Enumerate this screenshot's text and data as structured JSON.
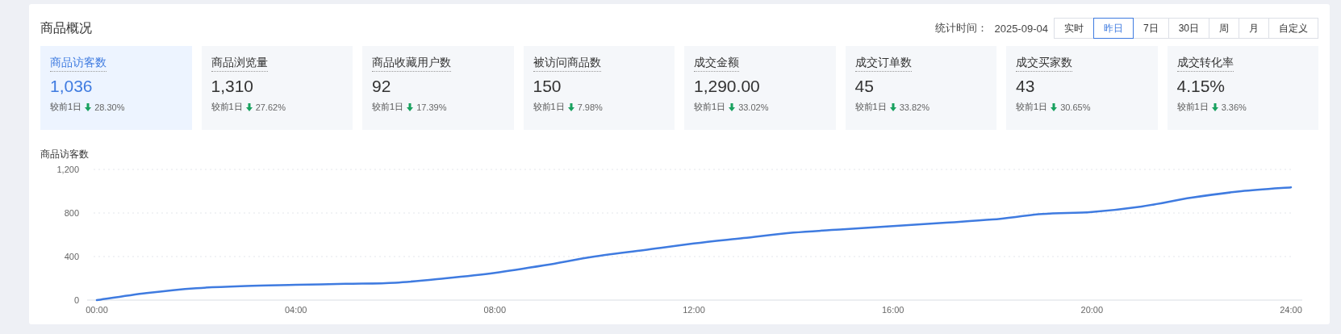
{
  "title": "商品概况",
  "stat_time": {
    "label": "统计时间：",
    "value": "2025-09-04"
  },
  "ranges": [
    {
      "label": "实时",
      "selected": false
    },
    {
      "label": "昨日",
      "selected": true
    },
    {
      "label": "7日",
      "selected": false
    },
    {
      "label": "30日",
      "selected": false
    },
    {
      "label": "周",
      "selected": false
    },
    {
      "label": "月",
      "selected": false
    },
    {
      "label": "自定义",
      "selected": false
    }
  ],
  "metrics": [
    {
      "name": "商品访客数",
      "value": "1,036",
      "compare": "较前1日",
      "kind": "decrease",
      "change": "28.30%",
      "selected": true
    },
    {
      "name": "商品浏览量",
      "value": "1,310",
      "compare": "较前1日",
      "kind": "decrease",
      "change": "27.62%",
      "selected": false
    },
    {
      "name": "商品收藏用户数",
      "value": "92",
      "compare": "较前1日",
      "kind": "decrease",
      "change": "17.39%",
      "selected": false
    },
    {
      "name": "被访问商品数",
      "value": "150",
      "compare": "较前1日",
      "kind": "decrease",
      "change": "7.98%",
      "selected": false
    },
    {
      "name": "成交金额",
      "value": "1,290.00",
      "compare": "较前1日",
      "kind": "decrease",
      "change": "33.02%",
      "selected": false
    },
    {
      "name": "成交订单数",
      "value": "45",
      "compare": "较前1日",
      "kind": "decrease",
      "change": "33.82%",
      "selected": false
    },
    {
      "name": "成交买家数",
      "value": "43",
      "compare": "较前1日",
      "kind": "decrease",
      "change": "30.65%",
      "selected": false
    },
    {
      "name": "成交转化率",
      "value": "4.15%",
      "compare": "较前1日",
      "kind": "decrease",
      "change": "3.36%",
      "selected": false
    }
  ],
  "chart": {
    "title": "商品访客数",
    "chart_data": {
      "type": "line",
      "x": [
        0,
        1,
        2,
        3,
        4,
        5,
        6,
        7,
        8,
        9,
        10,
        11,
        12,
        13,
        14,
        15,
        16,
        17,
        18,
        19,
        20,
        21,
        22,
        23,
        24
      ],
      "series": [
        {
          "color": "#3f7be0",
          "values": [
            0,
            65,
            110,
            130,
            140,
            150,
            160,
            200,
            250,
            320,
            400,
            460,
            520,
            570,
            620,
            650,
            680,
            710,
            740,
            790,
            810,
            860,
            940,
            1000,
            1036
          ]
        }
      ],
      "xlim": [
        0,
        24
      ],
      "ylim": [
        0,
        1200
      ],
      "xticks": [
        {
          "value": 0,
          "label": "00:00"
        },
        {
          "value": 4,
          "label": "04:00"
        },
        {
          "value": 8,
          "label": "08:00"
        },
        {
          "value": 12,
          "label": "12:00"
        },
        {
          "value": 16,
          "label": "16:00"
        },
        {
          "value": 20,
          "label": "20:00"
        },
        {
          "value": 24,
          "label": "24:00"
        }
      ],
      "yticks": [
        {
          "value": 0,
          "label": "0"
        },
        {
          "value": 400,
          "label": "400"
        },
        {
          "value": 800,
          "label": "800"
        },
        {
          "value": 1200,
          "label": "1,200"
        }
      ]
    }
  }
}
